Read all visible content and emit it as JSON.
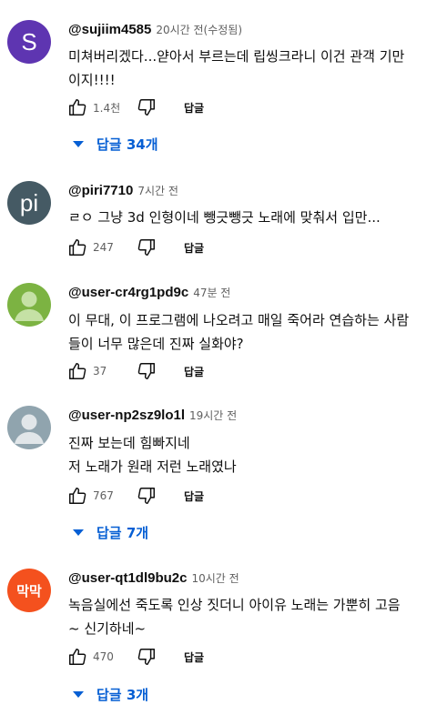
{
  "comments": [
    {
      "avatar_text": "S",
      "avatar_color": "#5e35b1",
      "handle": "@sujiim4585",
      "time": "20시간 전(수정됨)",
      "lines": [
        "미쳐버리겠다...얃아서 부르는데 립씽크라니 이건 관객 기만",
        "이지!!!!"
      ],
      "likes": "1.4천",
      "reply_label": "답글",
      "replies_label": "답글 34개"
    },
    {
      "avatar_text": "pi",
      "avatar_color": "#455a64",
      "handle": "@piri7710",
      "time": "7시간 전",
      "lines": [
        "ㄹㅇ 그냥 3d 인형이네 뺑긋뺑긋 노래에 맞춰서 입만..."
      ],
      "likes": "247",
      "reply_label": "답글"
    },
    {
      "avatar_text": "",
      "avatar_color": "#7cb342",
      "handle": "@user-cr4rg1pd9c",
      "time": "47분 전",
      "lines": [
        "이 무대, 이 프로그램에 나오려고 매일 죽어라 연습하는 사람",
        "들이 너무 많은데 진짜 실화야?"
      ],
      "likes": "37",
      "reply_label": "답글"
    },
    {
      "avatar_text": "",
      "avatar_color": "#90a4ae",
      "handle": "@user-np2sz9lo1l",
      "time": "19시간 전",
      "lines": [
        "진짜 보는데 힘빠지네",
        "저 노래가 원래 저런 노래였나"
      ],
      "likes": "767",
      "reply_label": "답글",
      "replies_label": "답글 7개"
    },
    {
      "avatar_text": "막막",
      "avatar_color": "#f4511e",
      "handle": "@user-qt1dl9bu2c",
      "time": "10시간 전",
      "lines": [
        "녹음실에선 죽도록 인상 짓더니 아이유 노래는 가뿐히 고음",
        "~ 신기하네~"
      ],
      "likes": "470",
      "reply_label": "답글",
      "replies_label": "답글 3개"
    }
  ]
}
